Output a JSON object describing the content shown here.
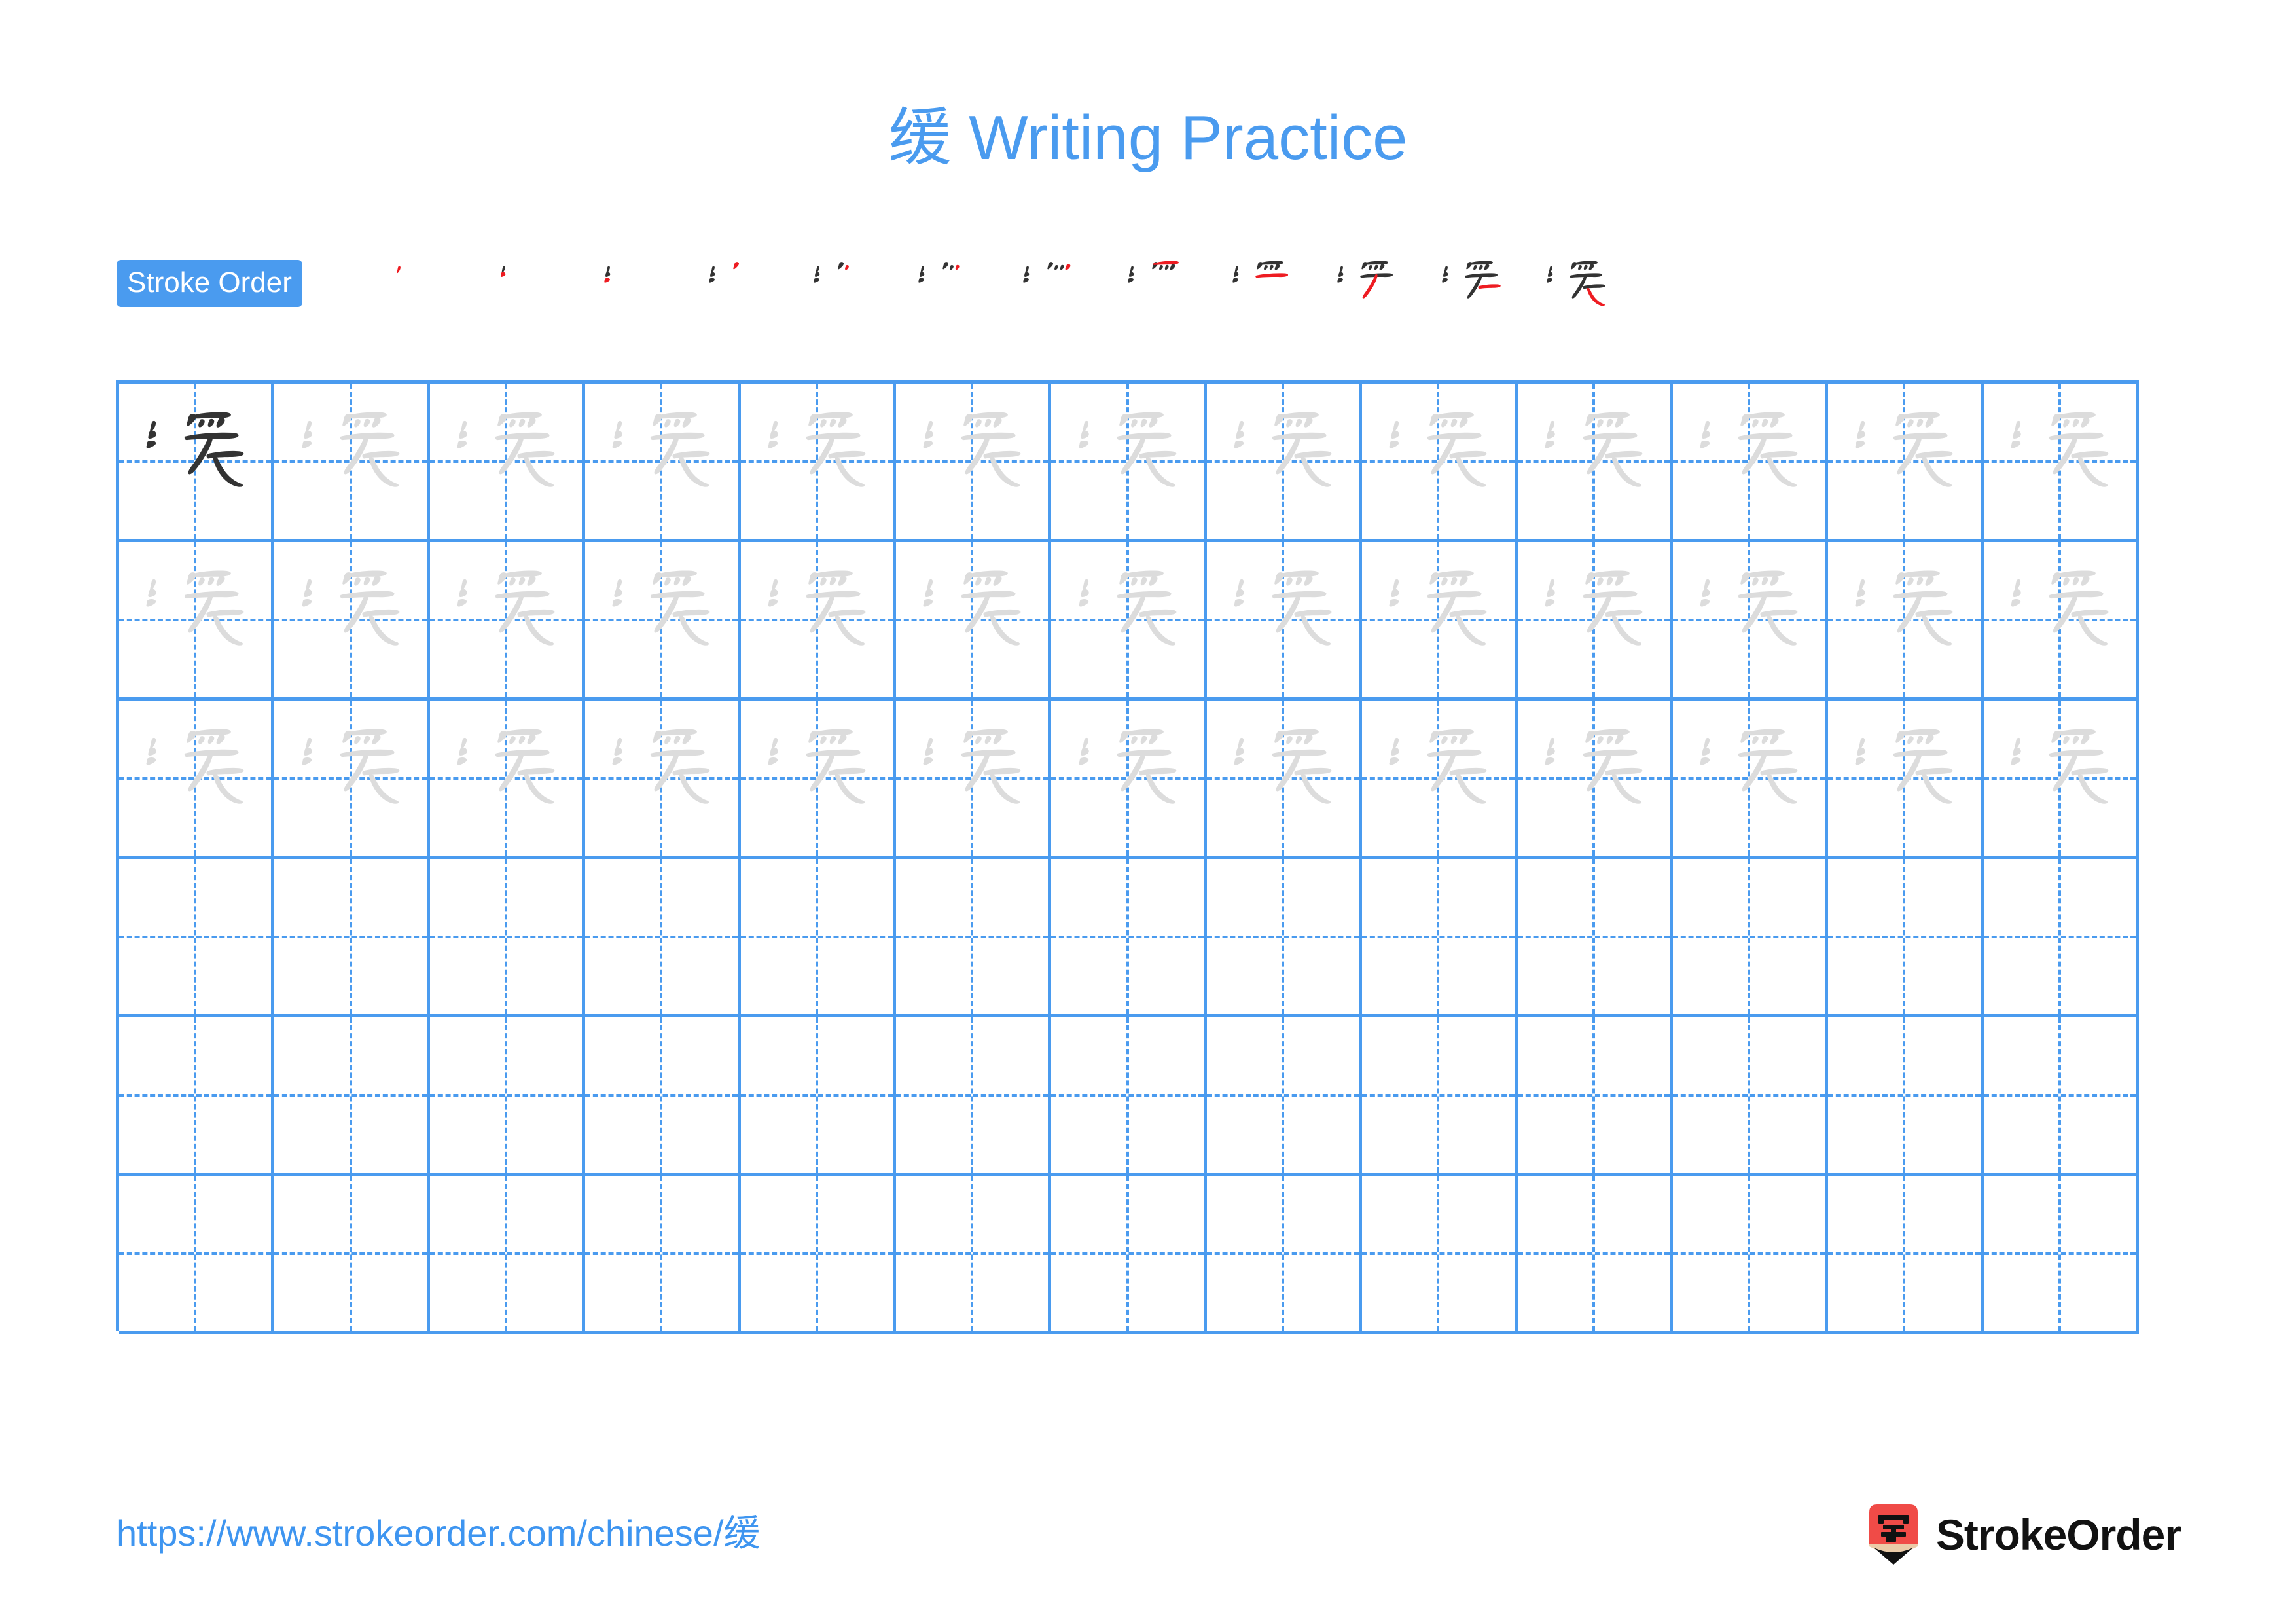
{
  "document": {
    "character": "缓",
    "title_prefix": "缓",
    "title_suffix": "Writing Practice",
    "title_full": "缓 Writing Practice"
  },
  "colors": {
    "accent_blue": "#4A9BEF",
    "grid_line": "#4A9BEF",
    "ghost_character": "#DCDCDC",
    "dark_character": "#333333",
    "new_stroke_red": "#EE1C22",
    "logo_red": "#F04B47",
    "logo_wood": "#EBCBA8",
    "link_blue": "#3E95F0"
  },
  "stroke_order": {
    "badge_label": "Stroke Order",
    "total_strokes": 12,
    "steps": [
      {
        "index": 1,
        "char": "缓",
        "strokes_drawn": 1,
        "new_stroke": 1
      },
      {
        "index": 2,
        "char": "缓",
        "strokes_drawn": 2,
        "new_stroke": 2
      },
      {
        "index": 3,
        "char": "缓",
        "strokes_drawn": 3,
        "new_stroke": 3
      },
      {
        "index": 4,
        "char": "缓",
        "strokes_drawn": 4,
        "new_stroke": 4
      },
      {
        "index": 5,
        "char": "缓",
        "strokes_drawn": 5,
        "new_stroke": 5
      },
      {
        "index": 6,
        "char": "缓",
        "strokes_drawn": 6,
        "new_stroke": 6
      },
      {
        "index": 7,
        "char": "缓",
        "strokes_drawn": 7,
        "new_stroke": 7
      },
      {
        "index": 8,
        "char": "缓",
        "strokes_drawn": 8,
        "new_stroke": 8
      },
      {
        "index": 9,
        "char": "缓",
        "strokes_drawn": 9,
        "new_stroke": 9
      },
      {
        "index": 10,
        "char": "缓",
        "strokes_drawn": 10,
        "new_stroke": 10
      },
      {
        "index": 11,
        "char": "缓",
        "strokes_drawn": 11,
        "new_stroke": 11
      },
      {
        "index": 12,
        "char": "缓",
        "strokes_drawn": 12,
        "new_stroke": 12
      }
    ]
  },
  "practice_grid": {
    "columns": 13,
    "rows": 6,
    "row_contents": [
      {
        "row": 1,
        "style": "first-dark-rest-ghost",
        "character": "缓",
        "filled_cells": 13
      },
      {
        "row": 2,
        "style": "ghost",
        "character": "缓",
        "filled_cells": 13
      },
      {
        "row": 3,
        "style": "ghost",
        "character": "缓",
        "filled_cells": 13
      },
      {
        "row": 4,
        "style": "empty",
        "character": "",
        "filled_cells": 0
      },
      {
        "row": 5,
        "style": "empty",
        "character": "",
        "filled_cells": 0
      },
      {
        "row": 6,
        "style": "empty",
        "character": "",
        "filled_cells": 0
      }
    ]
  },
  "footer": {
    "url": "https://www.strokeorder.com/chinese/缓",
    "brand_name": "StrokeOrder",
    "brand_mark_character": "字"
  }
}
